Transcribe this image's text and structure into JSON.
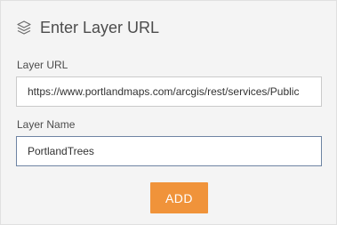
{
  "header": {
    "icon": "layers-icon",
    "title": "Enter Layer URL"
  },
  "layer_url": {
    "label": "Layer URL",
    "value": "https://www.portlandmaps.com/arcgis/rest/services/Public"
  },
  "layer_name": {
    "label": "Layer Name",
    "value": "PortlandTrees"
  },
  "actions": {
    "add_label": "ADD"
  },
  "colors": {
    "panel_background": "#f4f4f4",
    "button_accent": "#f0933a",
    "focus_border": "#6e84a3",
    "text": "#4c4c4c"
  }
}
